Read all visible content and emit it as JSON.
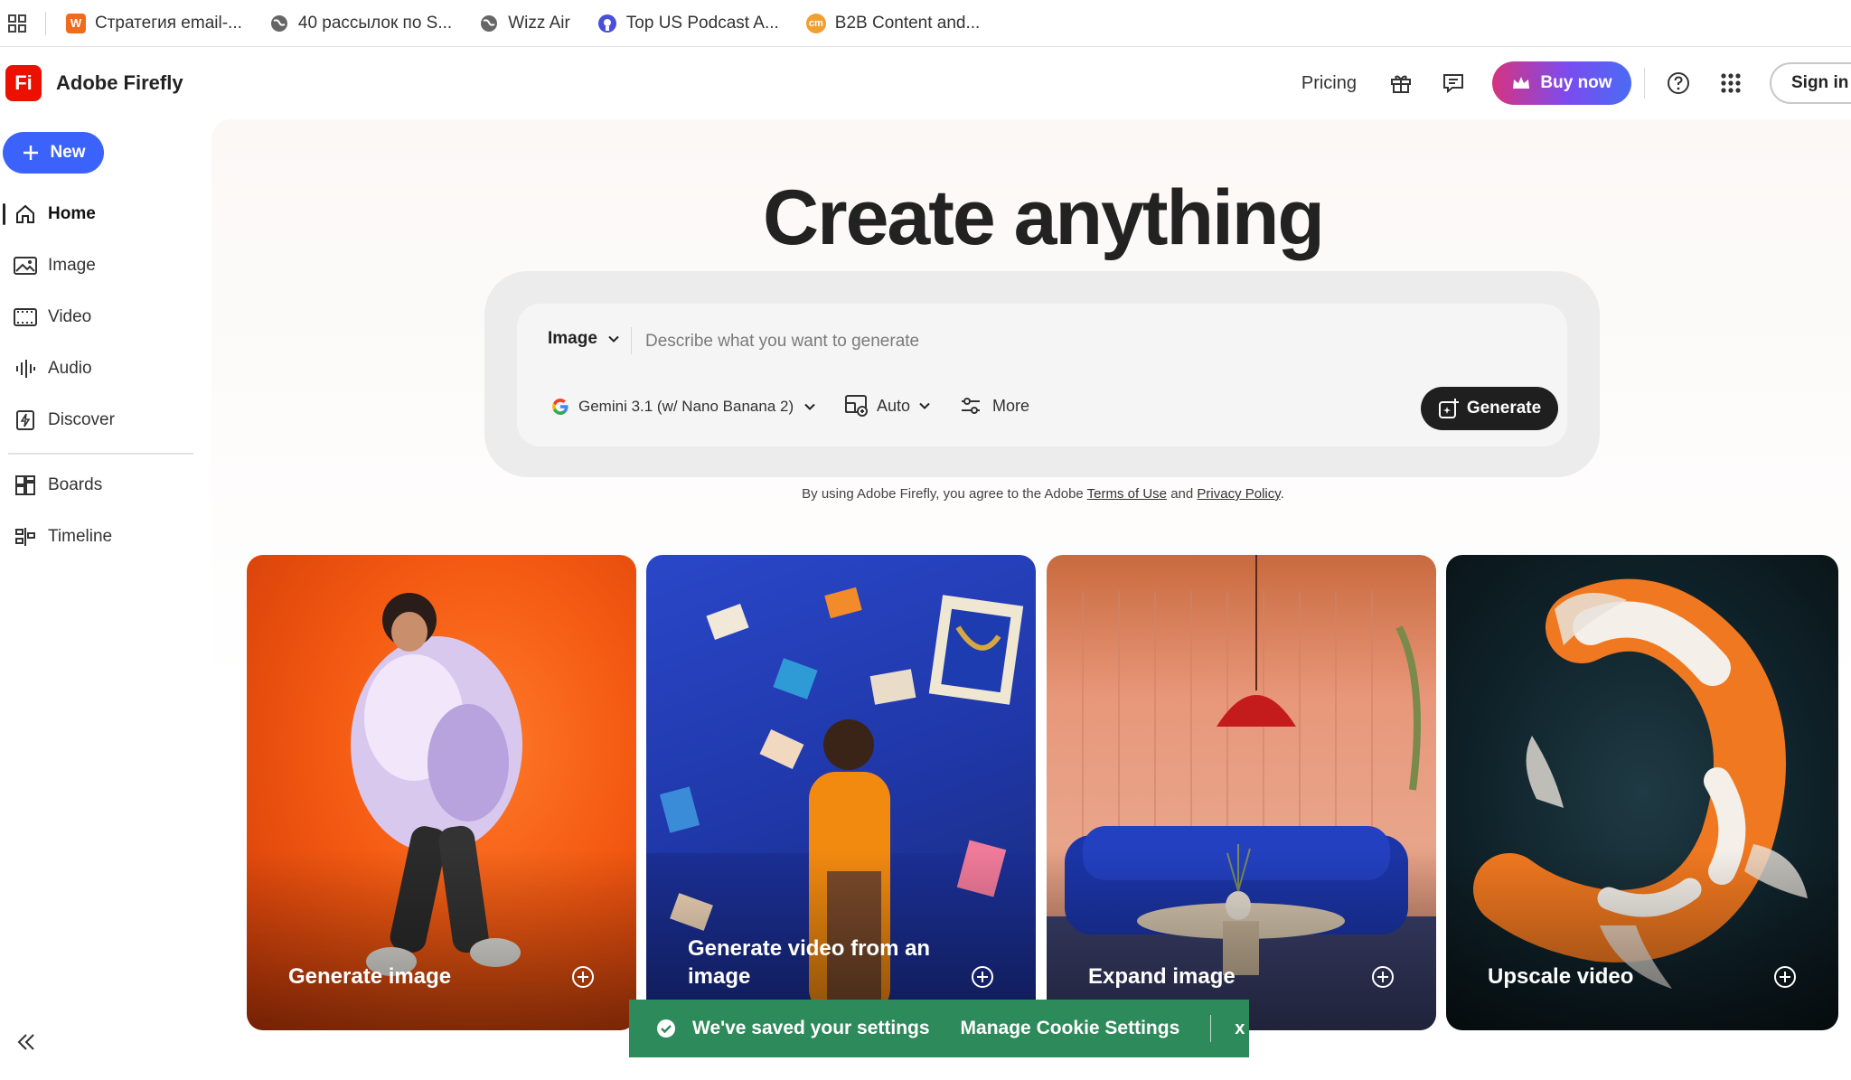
{
  "bookmarks": [
    {
      "label": "Стратегия email-...",
      "icon": "W",
      "color": "#f26b1d"
    },
    {
      "label": "40 рассылок по S...",
      "icon": "globe-icon",
      "color": "#555555"
    },
    {
      "label": "Wizz Air",
      "icon": "globe-icon",
      "color": "#555555"
    },
    {
      "label": "Top US Podcast A...",
      "icon": "podcast-icon",
      "color": "#4a4fd8"
    },
    {
      "label": "B2B Content and...",
      "icon": "cm",
      "color": "#f0a030"
    }
  ],
  "header": {
    "logo_text": "Fi",
    "app_name": "Adobe Firefly",
    "pricing": "Pricing",
    "buy_now": "Buy now",
    "sign_in": "Sign in"
  },
  "sidebar": {
    "new_label": "New",
    "items": [
      {
        "label": "Home",
        "icon": "home-icon",
        "active": true
      },
      {
        "label": "Image",
        "icon": "image-icon"
      },
      {
        "label": "Video",
        "icon": "video-icon"
      },
      {
        "label": "Audio",
        "icon": "audio-icon"
      },
      {
        "label": "Discover",
        "icon": "discover-icon"
      },
      {
        "label": "Boards",
        "icon": "boards-icon"
      },
      {
        "label": "Timeline",
        "icon": "timeline-icon"
      }
    ]
  },
  "main": {
    "title": "Create anything",
    "prompt": {
      "type": "Image",
      "placeholder": "Describe what you want to generate",
      "model": "Gemini 3.1 (w/ Nano Banana 2)",
      "aspect": "Auto",
      "more": "More",
      "generate": "Generate"
    },
    "terms": {
      "prefix": "By using Adobe Firefly, you agree to the Adobe ",
      "terms_link": "Terms of Use",
      "and": " and ",
      "privacy_link": "Privacy Policy",
      "suffix": "."
    },
    "cards": [
      {
        "label": "Generate image"
      },
      {
        "label": "Generate video from an image"
      },
      {
        "label": "Expand image"
      },
      {
        "label": "Upscale video"
      }
    ]
  },
  "toast": {
    "message": "We've saved your settings",
    "manage": "Manage Cookie Settings",
    "close": "x"
  },
  "colors": {
    "brand": "#eb1000",
    "primary": "#3b63fb",
    "toast": "#2d8a5a"
  }
}
